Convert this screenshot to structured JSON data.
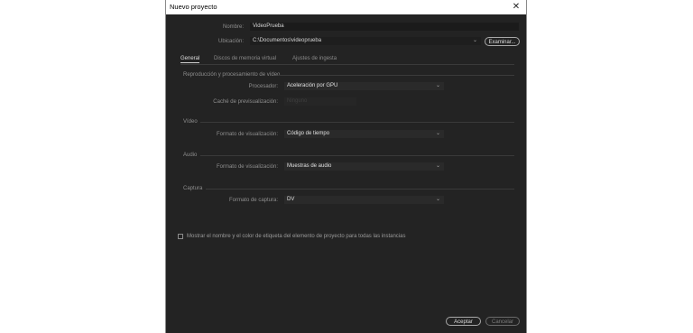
{
  "window": {
    "title": "Nuevo proyecto",
    "close_glyph": "✕"
  },
  "form": {
    "name_label": "Nombre:",
    "name_value": "VideoPrueba",
    "location_label": "Ubicación:",
    "location_value": "C:\\Documentos\\videoprueba",
    "browse_label": "Examinar..."
  },
  "tabs": [
    "General",
    "Discos de memoria virtual",
    "Ajustes de ingesta"
  ],
  "active_tab": "General",
  "sections": {
    "render": {
      "title": "Reproducción y procesamiento de vídeo",
      "processor_label": "Procesador:",
      "processor_value": "Aceleración por GPU",
      "cache_label": "Caché de previsualización:",
      "cache_value": "Ninguno"
    },
    "video": {
      "title": "Vídeo",
      "display_label": "Formato de visualización:",
      "display_value": "Código de tiempo"
    },
    "audio": {
      "title": "Audio",
      "display_label": "Formato de visualización:",
      "display_value": "Muestras de audio"
    },
    "capture": {
      "title": "Captura",
      "format_label": "Formato de captura:",
      "format_value": "DV"
    }
  },
  "checkbox": {
    "label": "Mostrar el nombre y el color de etiqueta del elemento de proyecto para todas las instancias",
    "checked": false
  },
  "footer": {
    "ok_label": "Aceptar",
    "cancel_label": "Cancelar"
  },
  "icons": {
    "dropdown": "chevron-down-icon",
    "close": "close-icon"
  },
  "colors": {
    "background": "#232323",
    "field": "#1b1b1b",
    "text": "#d7d7d7",
    "label": "#8e8e8e"
  }
}
